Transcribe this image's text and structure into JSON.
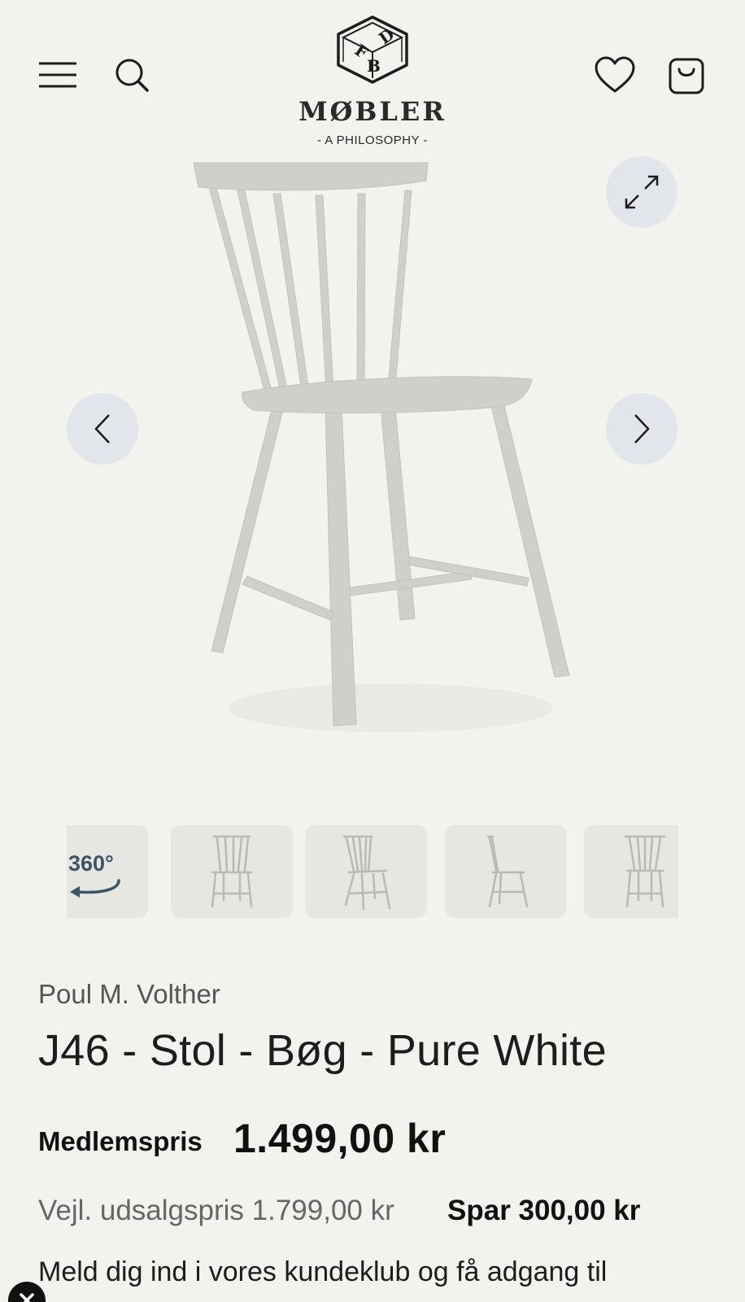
{
  "header": {
    "logo_letters": [
      "F",
      "D",
      "B"
    ],
    "logo_name": "MØBLER",
    "logo_tagline": "- A PHILOSOPHY -",
    "icons": [
      "menu-icon",
      "search-icon",
      "heart-icon",
      "bag-icon"
    ]
  },
  "gallery": {
    "icons": [
      "expand-icon",
      "chevron-left-icon",
      "chevron-right-icon"
    ],
    "thumbnails": [
      {
        "label": "360°",
        "icon": "rotate-360-icon"
      },
      {
        "icon": "chair-front-icon"
      },
      {
        "icon": "chair-angle-icon"
      },
      {
        "icon": "chair-side-icon"
      },
      {
        "icon": "chair-back-icon"
      }
    ]
  },
  "product": {
    "designer": "Poul M. Volther",
    "title": "J46 - Stol - Bøg - Pure White",
    "member_label": "Medlemspris",
    "member_price": "1.499,00 kr",
    "retail_price": "Vejl. udsalgspris 1.799,00 kr",
    "savings": "Spar 300,00 kr",
    "club_text": "Meld dig ind i vores kundeklub og få adgang til"
  },
  "colors": {
    "background": "#f2f2ee",
    "button_bg": "#e2e6ea",
    "chair": "#cfd0cc",
    "text": "#1d1d1d"
  }
}
